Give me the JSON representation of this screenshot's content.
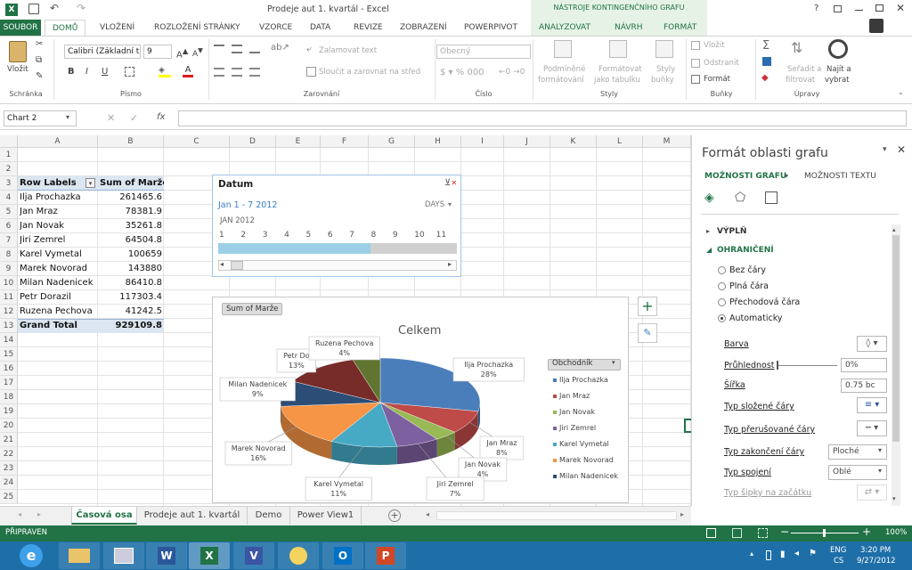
{
  "window": {
    "title": "Prodeje aut 1. kvartál - Excel",
    "context_tab_title": "NÁSTROJE KONTINGENČNÍHO GRAFU",
    "help_glyph": "?"
  },
  "tabs": [
    "SOUBOR",
    "DOMŮ",
    "VLOŽENÍ",
    "ROZLOŽENÍ STRÁNKY",
    "VZORCE",
    "DATA",
    "REVIZE",
    "ZOBRAZENÍ",
    "POWERPIVOT",
    "ANALYZOVAT",
    "NÁVRH",
    "FORMÁT"
  ],
  "ribbon": {
    "groups": [
      "Schránka",
      "Písmo",
      "Zarovnání",
      "Číslo",
      "Styly",
      "Buňky",
      "Úpravy"
    ],
    "paste": "Vložit",
    "font_name": "Calibri (Základní t",
    "font_size": "9",
    "bold": "B",
    "italic": "I",
    "underline": "U",
    "wrap_text": "Zalamovat text",
    "merge_center": "Sloučit a zarovnat na střed",
    "number_format": "Obecný",
    "conditional_formatting": [
      "Podmíněné",
      "formátování"
    ],
    "format_as_table": [
      "Formátovat",
      "jako tabulku"
    ],
    "cell_styles": [
      "Styly",
      "buňky"
    ],
    "insert": "Vložit",
    "delete": "Odstranit",
    "format": "Formát",
    "sort_filter": [
      "Seřadit a",
      "filtrovat"
    ],
    "find_select": [
      "Najít a",
      "vybrat"
    ],
    "sigma": "Σ"
  },
  "formula_bar": {
    "name_box": "Chart 2",
    "fx": "fx",
    "value": ""
  },
  "columns": [
    "A",
    "B",
    "C",
    "D",
    "E",
    "F",
    "G",
    "H",
    "I",
    "J",
    "K",
    "L",
    "M"
  ],
  "rows": [
    "1",
    "2",
    "3",
    "4",
    "5",
    "6",
    "7",
    "8",
    "9",
    "10",
    "11",
    "12",
    "13",
    "14",
    "15",
    "16",
    "17",
    "18",
    "19",
    "20",
    "21",
    "22",
    "23",
    "24",
    "25"
  ],
  "pivot": {
    "header": [
      "Row Labels",
      "Sum of Marže"
    ],
    "rows": [
      [
        "Ilja Prochazka",
        "261465.6"
      ],
      [
        "Jan Mraz",
        "78381.9"
      ],
      [
        "Jan Novak",
        "35261.8"
      ],
      [
        "Jiri Zemrel",
        "64504.8"
      ],
      [
        "Karel Vymetal",
        "100659"
      ],
      [
        "Marek Novorad",
        "143880"
      ],
      [
        "Milan Nadenicek",
        "86410.8"
      ],
      [
        "Petr Dorazil",
        "117303.4"
      ],
      [
        "Ruzena Pechova",
        "41242.5"
      ]
    ],
    "total": [
      "Grand Total",
      "929109.8"
    ]
  },
  "slicer": {
    "title": "Datum",
    "range": "Jan 1 - 7 2012",
    "level": "DAYS",
    "period": "JAN 2012",
    "ticks": [
      "1",
      "2",
      "3",
      "4",
      "5",
      "6",
      "7",
      "8",
      "9",
      "10",
      "11"
    ],
    "selected_days": 7
  },
  "chart": {
    "field_button": "Sum of Marže",
    "title": "Celkem",
    "legend_button": "Obchodník",
    "slices": [
      {
        "name": "Ilja Prochazka",
        "pct": "28%",
        "value": 261465.6,
        "color": "#4a7ebb"
      },
      {
        "name": "Jan Mraz",
        "pct": "8%",
        "value": 78381.9,
        "color": "#be4b48"
      },
      {
        "name": "Jan Novak",
        "pct": "4%",
        "value": 35261.8,
        "color": "#98b954"
      },
      {
        "name": "Jiri Zemrel",
        "pct": "7%",
        "value": 64504.8,
        "color": "#7d60a0"
      },
      {
        "name": "Karel Vymetal",
        "pct": "11%",
        "value": 100659,
        "color": "#46aac5"
      },
      {
        "name": "Marek Novorad",
        "pct": "16%",
        "value": 143880,
        "color": "#f69545"
      },
      {
        "name": "Milan Nadenicek",
        "pct": "9%",
        "value": 86410.8,
        "color": "#2c4d75"
      },
      {
        "name": "Petr Dorazil",
        "pct": "13%",
        "value": 117303.4,
        "color": "#772c2a"
      },
      {
        "name": "Ruzena Pechova",
        "pct": "4%",
        "value": 41242.5,
        "color": "#5f7530"
      }
    ],
    "legend_items": [
      "Ilja Prochazka",
      "Jan Mraz",
      "Jan Novak",
      "Jiri Zemrel",
      "Karel Vymetal",
      "Marek Novorad",
      "Milan Nadenicek"
    ],
    "label_texts": {
      "petr_partial": "Petr Do"
    }
  },
  "chart_data": {
    "type": "pie",
    "title": "Celkem",
    "categories": [
      "Ilja Prochazka",
      "Jan Mraz",
      "Jan Novak",
      "Jiri Zemrel",
      "Karel Vymetal",
      "Marek Novorad",
      "Milan Nadenicek",
      "Petr Dorazil",
      "Ruzena Pechova"
    ],
    "values": [
      261465.6,
      78381.9,
      35261.8,
      64504.8,
      100659,
      143880,
      86410.8,
      117303.4,
      41242.5
    ],
    "percent_labels": [
      "28%",
      "8%",
      "4%",
      "7%",
      "11%",
      "16%",
      "9%",
      "13%",
      "4%"
    ],
    "legend_title": "Obchodník",
    "legend_position": "right"
  },
  "pane": {
    "title": "Formát oblasti grafu",
    "tab_chart": "MOŽNOSTI GRAFU",
    "tab_text": "MOŽNOSTI TEXTU",
    "section_fill": "VÝPLŇ",
    "section_border": "OHRANIČENÍ",
    "radios": [
      "Bez čáry",
      "Plná čára",
      "Přechodová čára",
      "Automaticky"
    ],
    "props": [
      {
        "label": "Barva",
        "value": ""
      },
      {
        "label": "Průhlednost",
        "value": "0%"
      },
      {
        "label": "Šířka",
        "value": "0.75 bc"
      },
      {
        "label": "Typ složené čáry",
        "value": ""
      },
      {
        "label": "Typ přerušované čáry",
        "value": ""
      },
      {
        "label": "Typ zakončení čáry",
        "value": "Ploché"
      },
      {
        "label": "Typ spojení",
        "value": "Oblé"
      },
      {
        "label": "Typ šipky na začátku",
        "value": ""
      }
    ]
  },
  "sheets": [
    "Časová osa",
    "Prodeje aut 1. kvartál",
    "Demo",
    "Power View1"
  ],
  "status": {
    "ready": "PŘIPRAVEN",
    "zoom": "100%"
  },
  "taskbar": {
    "lang1": "ENG",
    "lang2": "CS",
    "time": "3:20 PM",
    "date": "9/27/2012"
  },
  "colors": {
    "accent": "#217346",
    "taskbar": "#1e6fa8"
  }
}
